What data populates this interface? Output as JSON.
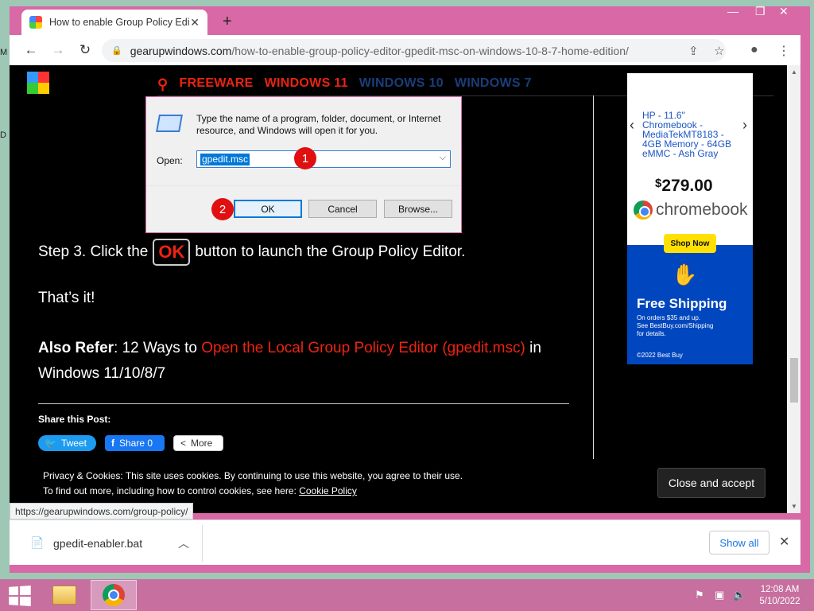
{
  "browser": {
    "tab_title": "How to enable Group Policy Editor",
    "tab_close": "✕",
    "new_tab": "+",
    "url_domain": "gearupwindows.com",
    "url_path": "/how-to-enable-group-policy-editor-gpedit-msc-on-windows-10-8-7-home-edition/",
    "status_url": "https://gearupwindows.com/group-policy/"
  },
  "site": {
    "nav": [
      "FREEWARE",
      "WINDOWS 11",
      "WINDOWS 10",
      "WINDOWS 7"
    ],
    "step3_prefix": "Step 3. Click the",
    "ok_badge": "OK",
    "step3_suffix": "button to launch the Group Policy Editor.",
    "thats_it": "That’s it!",
    "also_label": "Also Refer",
    "also_mid": ": 12 Ways to ",
    "also_link": "Open the Local Group Policy Editor (gpedit.msc)",
    "also_tail": " in Windows 11/10/8/7",
    "share_title": "Share this Post:",
    "tweet": "Tweet",
    "fb_share": "Share 0",
    "more": "More"
  },
  "cookie": {
    "line1": "Privacy & Cookies: This site uses cookies. By continuing to use this website, you agree to their use.",
    "line2_prefix": "To find out more, including how to control cookies, see here: ",
    "link": "Cookie Policy",
    "close_accept": "Close and accept"
  },
  "ad": {
    "title": "HP - 11.6\" Chromebook - MediaTekMT8183 - 4GB Memory - 64GB eMMC - Ash Gray",
    "price_symbol": "$",
    "price": "279.00",
    "brand": "chromebook",
    "shop_now": "Shop Now",
    "free_shipping": "Free Shipping",
    "fine1": "On orders $35 and up.",
    "fine2": "See BestBuy.com/Shipping",
    "fine3": "for details.",
    "copyright": "©2022 Best Buy"
  },
  "run_dialog": {
    "message": "Type the name of a program, folder, document, or Internet resource, and Windows will open it for you.",
    "open_label": "Open:",
    "input_value": "gpedit.msc",
    "ok": "OK",
    "cancel": "Cancel",
    "browse": "Browse...",
    "callout_1": "1",
    "callout_2": "2"
  },
  "downloads": {
    "file": "gpedit-enabler.bat",
    "show_all": "Show all"
  },
  "taskbar": {
    "time": "12:08 AM",
    "date": "5/10/2022"
  },
  "colors": {
    "accent_red": "#e21111",
    "window_frame": "#d869a6",
    "nav_blue": "#1a3d7a"
  }
}
